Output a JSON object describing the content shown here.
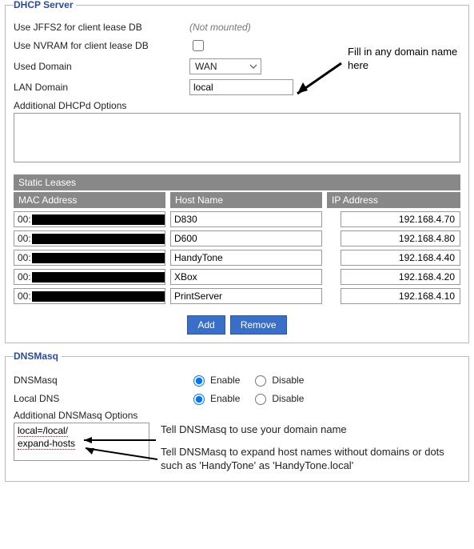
{
  "dhcp": {
    "title": "DHCP Server",
    "jffs2_label": "Use JFFS2 for client lease DB",
    "jffs2_value": "(Not mounted)",
    "nvram_label": "Use NVRAM for client lease DB",
    "nvram_checked": false,
    "used_domain_label": "Used Domain",
    "used_domain_value": "WAN",
    "lan_domain_label": "LAN Domain",
    "lan_domain_value": "local",
    "addl_options_label": "Additional DHCPd Options",
    "addl_options_value": "",
    "static_leases_header": "Static Leases",
    "th_mac": "MAC Address",
    "th_host": "Host Name",
    "th_ip": "IP Address",
    "leases": [
      {
        "mac_prefix": "00:",
        "host": "D830",
        "ip": "192.168.4.70"
      },
      {
        "mac_prefix": "00:",
        "host": "D600",
        "ip": "192.168.4.80"
      },
      {
        "mac_prefix": "00:",
        "host": "HandyTone",
        "ip": "192.168.4.40"
      },
      {
        "mac_prefix": "00:",
        "host": "XBox",
        "ip": "192.168.4.20"
      },
      {
        "mac_prefix": "00:",
        "host": "PrintServer",
        "ip": "192.168.4.10"
      }
    ],
    "add_btn": "Add",
    "remove_btn": "Remove"
  },
  "dnsmasq": {
    "title": "DNSMasq",
    "dnsmasq_label": "DNSMasq",
    "localdns_label": "Local DNS",
    "enable": "Enable",
    "disable": "Disable",
    "dnsmasq_selected": "enable",
    "localdns_selected": "enable",
    "addl_label": "Additional DNSMasq Options",
    "addl_line1": "local=/local/",
    "addl_line2": "expand-hosts"
  },
  "annotations": {
    "fill_domain": "Fill in any domain name here",
    "tell_domain": "Tell DNSMasq to use your domain name",
    "tell_expand": "Tell DNSMasq to expand host names without domains or dots such as 'HandyTone' as 'HandyTone.local'"
  }
}
